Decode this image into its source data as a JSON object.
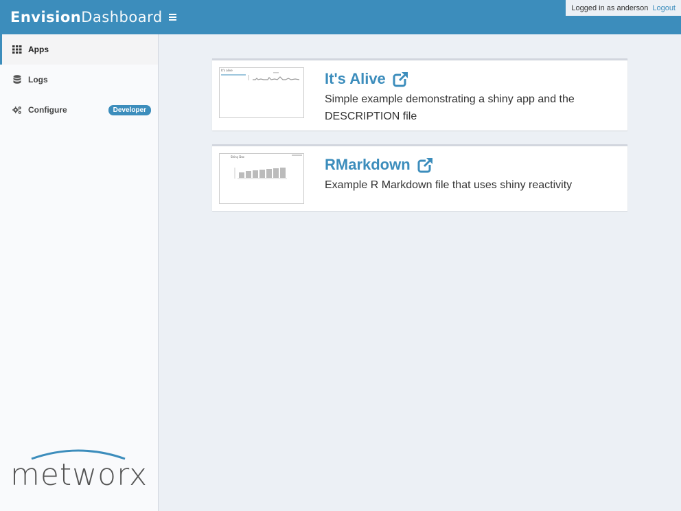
{
  "brand": {
    "bold": "Envision",
    "light": "Dashboard"
  },
  "user": {
    "logged_in_text": "Logged in as anderson",
    "logout_label": "Logout"
  },
  "sidebar": {
    "items": [
      {
        "label": "Apps",
        "icon": "grid-icon"
      },
      {
        "label": "Logs",
        "icon": "database-icon"
      },
      {
        "label": "Configure",
        "icon": "gears-icon",
        "badge": "Developer"
      }
    ],
    "logo_text": "metworx"
  },
  "apps": [
    {
      "title": "It's Alive",
      "description": "Simple example demonstrating a shiny app and the DESCRIPTION file",
      "icon": "external-link-icon"
    },
    {
      "title": "RMarkdown",
      "description": "Example R Markdown file that uses shiny reactivity",
      "icon": "external-link-icon"
    }
  ],
  "colors": {
    "header": "#3c8dbc",
    "accent": "#3c8dbc",
    "content_bg": "#ecf0f5",
    "sidebar_bg": "#f9fafc"
  }
}
